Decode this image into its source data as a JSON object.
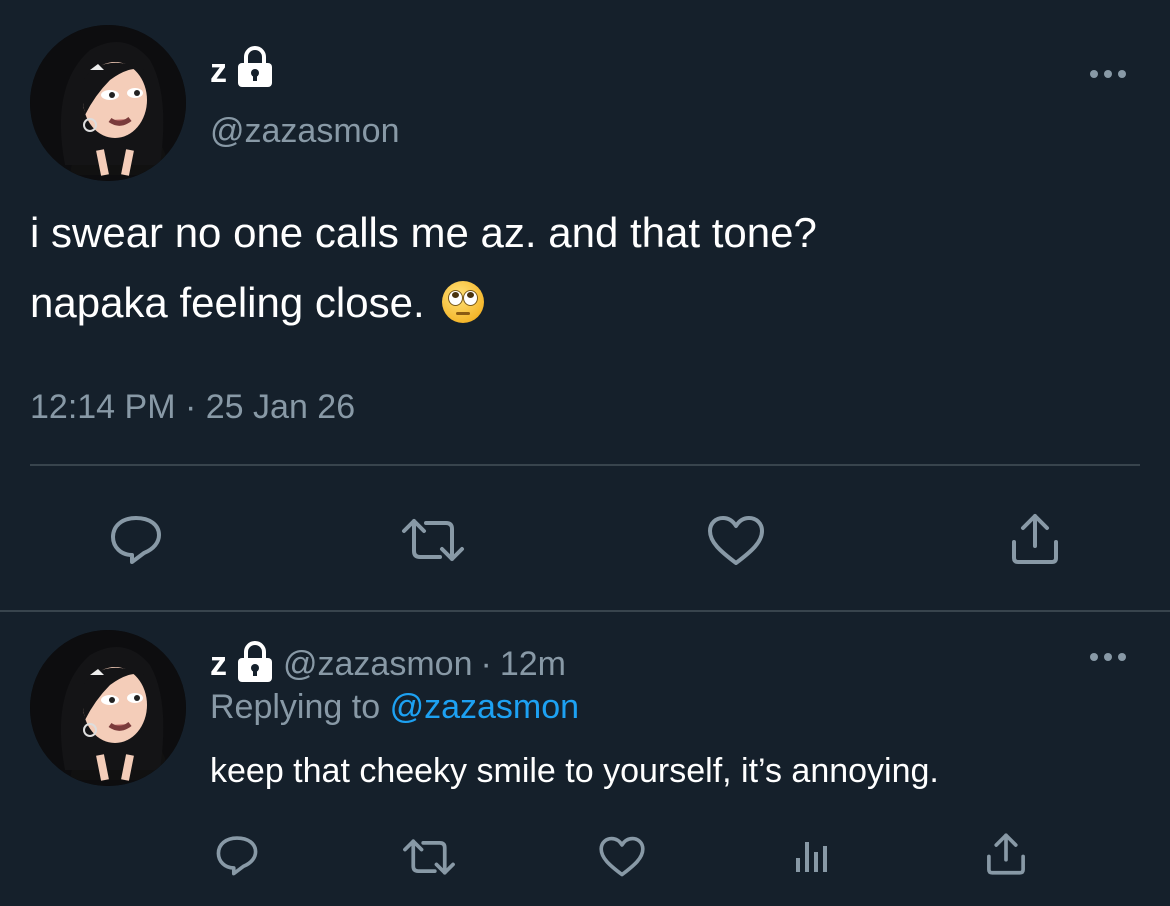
{
  "main_tweet": {
    "display_name": "z",
    "handle": "@zazasmon",
    "text_line1": "i swear no one calls me az. and that tone?",
    "text_line2": "napaka feeling close.",
    "emoji": "face-with-rolling-eyes",
    "time": "12:14 PM",
    "separator": "·",
    "date": "25 Jan 26",
    "actions": [
      "reply-icon",
      "retweet-icon",
      "like-icon",
      "share-icon"
    ]
  },
  "reply_tweet": {
    "display_name": "z",
    "handle": "@zazasmon",
    "separator": "·",
    "age": "12m",
    "replying_prefix": "Replying to",
    "replying_to": "@zazasmon",
    "text": "keep that cheeky smile to yourself, it’s annoying.",
    "actions": [
      "reply-icon",
      "retweet-icon",
      "like-icon",
      "analytics-icon",
      "share-icon"
    ]
  },
  "colors": {
    "background": "#15202b",
    "secondary_text": "#8899a6",
    "link": "#1da1f2",
    "divider": "#38444d"
  }
}
